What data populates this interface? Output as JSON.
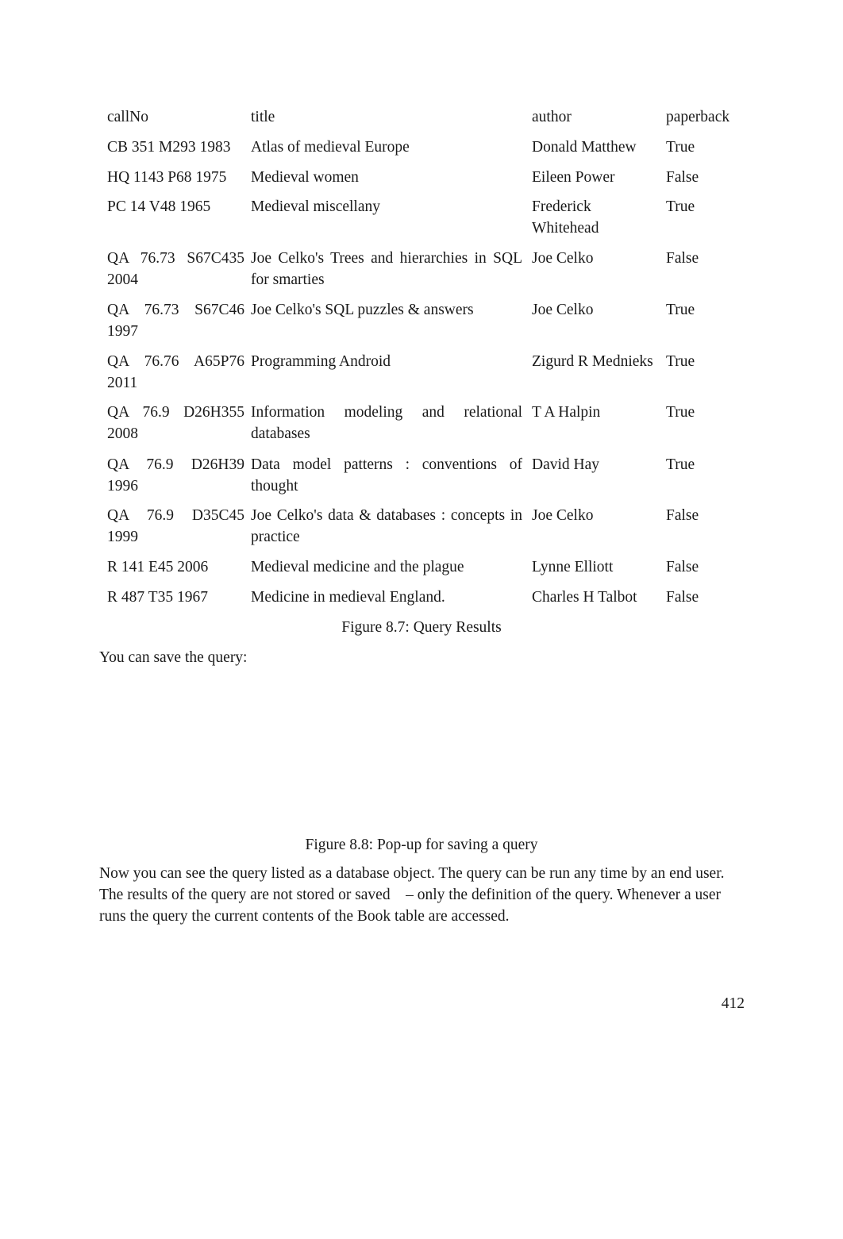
{
  "table": {
    "headers": [
      "callNo",
      "title",
      "author",
      "paperback"
    ],
    "rows": [
      {
        "callNo": "CB 351 M293 1983",
        "title": "Atlas of medieval Europe",
        "author": "Donald Matthew",
        "paperback": "True"
      },
      {
        "callNo": "HQ 1143 P68 1975",
        "title": "Medieval women",
        "author": "Eileen Power",
        "paperback": "False"
      },
      {
        "callNo": "PC 14 V48 1965",
        "title": "Medieval miscellany",
        "author": "Frederick Whitehead",
        "paperback": "True"
      },
      {
        "callNo": "QA 76.73 S67C435 2004",
        "title": "Joe Celko's Trees and hierarchies in SQL for smarties",
        "author": "Joe Celko",
        "paperback": "False"
      },
      {
        "callNo": "QA 76.73 S67C46 1997",
        "title": "Joe Celko's SQL puzzles & answers",
        "author": "Joe Celko",
        "paperback": "True"
      },
      {
        "callNo": "QA 76.76 A65P76 2011",
        "title": "Programming Android",
        "author": "Zigurd R Mednieks",
        "paperback": "True"
      },
      {
        "callNo": "QA 76.9 D26H355 2008",
        "title": "Information modeling and relational databases",
        "author": "T A Halpin",
        "paperback": "True"
      },
      {
        "callNo": "QA 76.9 D26H39 1996",
        "title": "Data model patterns : conventions of thought",
        "author": "David Hay",
        "paperback": "True"
      },
      {
        "callNo": "QA 76.9 D35C45 1999",
        "title": "Joe Celko's data & databases : concepts in practice",
        "author": "Joe Celko",
        "paperback": "False"
      },
      {
        "callNo": "R 141 E45 2006",
        "title": "Medieval medicine and the plague",
        "author": "Lynne Elliott",
        "paperback": "False"
      },
      {
        "callNo": "R 487 T35 1967",
        "title": "Medicine in medieval England.",
        "author": "Charles H Talbot",
        "paperback": "False"
      }
    ]
  },
  "figure_8_7_caption": "Figure 8.7: Query Results",
  "intro_text": "You can save the query:",
  "figure_8_8_caption": "Figure 8.8: Pop-up for saving a query",
  "body_paragraph": "Now you can see the query listed as a database object. The query can be run any time by an end user. The results of the query are not stored or saved    – only the definition of the query. Whenever a user runs the query the current contents of the Book table are accessed.",
  "page_number": "412"
}
